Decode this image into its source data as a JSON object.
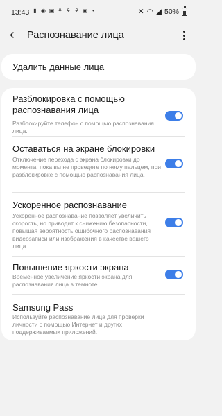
{
  "status_bar": {
    "time": "13:43",
    "battery": "50%"
  },
  "header": {
    "title": "Распознавание лица"
  },
  "actions": {
    "delete_label": "Удалить данные лица"
  },
  "settings": [
    {
      "label": "Разблокировка с помощью распознавания лица",
      "description": "Разблокируйте телефон с помощью распознавания лица.",
      "enabled": true
    },
    {
      "label": "Оставаться на экране блокировки",
      "description": "Отключение перехода с экрана блокировки до момента, пока вы не проведете по нему пальцем, при разблокировке с помощью распознавания лица.",
      "enabled": true
    },
    {
      "label": "Ускоренное распознавание",
      "description": "Ускоренное распознавание позволяет увеличить скорость, но приводит к снижению безопасности, повышая вероятность ошибочного распознавания видеозаписи или изображения в качестве вашего лица.",
      "enabled": true
    },
    {
      "label": "Повышение яркости экрана",
      "description": "Временное увеличение яркости экрана для распознавания лица в темноте.",
      "enabled": true
    },
    {
      "label": "Samsung Pass",
      "description": "Используйте распознавание лица для проверки личности с помощью Интернет и других поддерживаемых приложений."
    }
  ],
  "colors": {
    "accent": "#3d7ee8",
    "background": "#f2f2f2"
  }
}
